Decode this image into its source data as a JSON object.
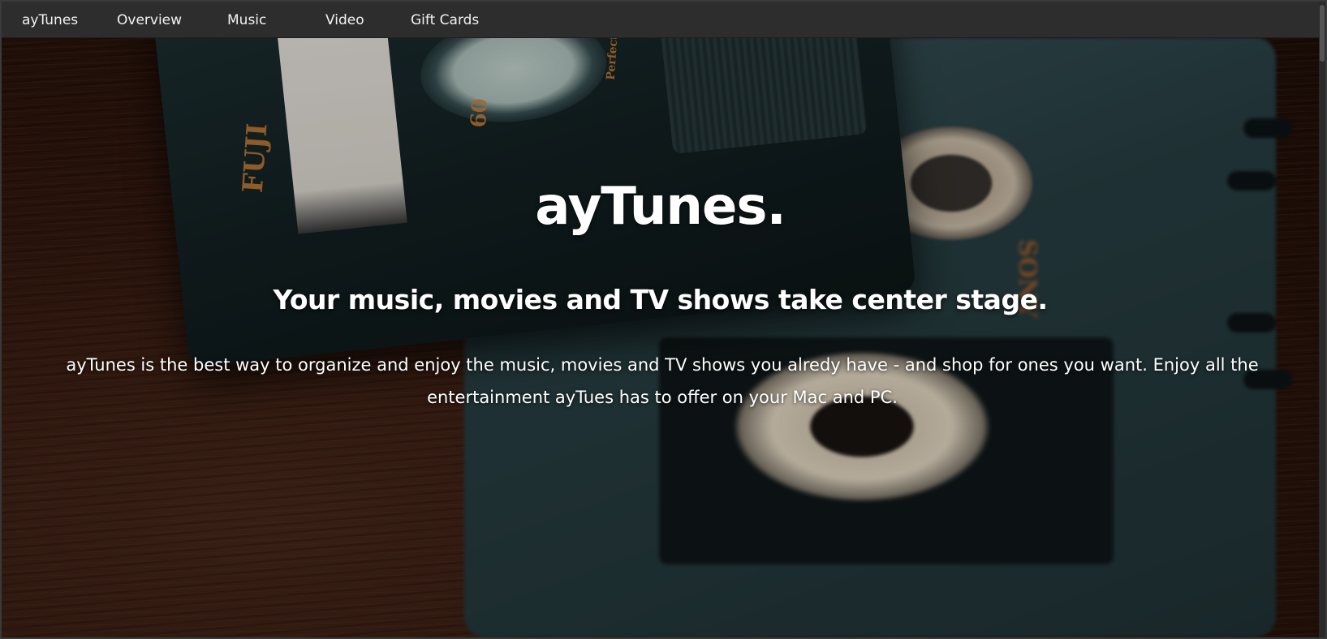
{
  "nav": {
    "brand": "ayTunes",
    "items": [
      {
        "label": "Overview"
      },
      {
        "label": "Music"
      },
      {
        "label": "Video"
      },
      {
        "label": "Gift Cards"
      }
    ]
  },
  "hero": {
    "title": "ayTunes.",
    "subtitle": "Your music, movies and TV shows take center stage.",
    "description": "ayTunes is the best way to organize and enjoy the music, movies and TV shows you alredy have - and shop for ones you want. Enjoy all the entertainment ayTues has to offer on your Mac and PC.",
    "background_image": "cassette-tapes-on-wood-photo",
    "cassette_labels": {
      "brand_front": "FUJI",
      "length": "60",
      "tagline": "Perfect for Everyday Music",
      "brand_back": "SONY"
    }
  },
  "colors": {
    "navbar_bg": "#2d2d2d",
    "nav_text": "#f2f2f2",
    "hero_text": "#ffffff"
  }
}
